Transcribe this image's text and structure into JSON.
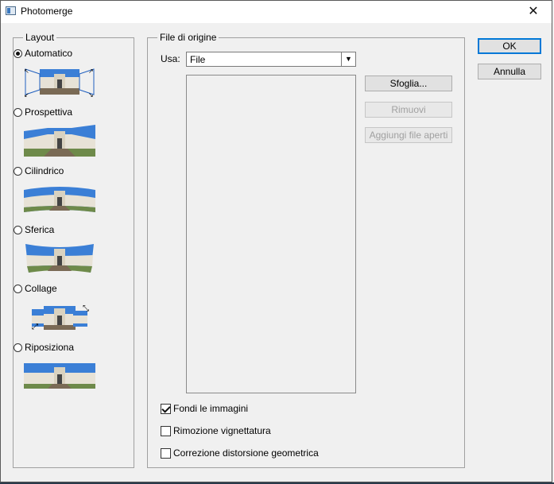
{
  "window": {
    "title": "Photomerge"
  },
  "layout": {
    "legend": "Layout",
    "options": [
      {
        "label": "Automatico",
        "checked": true
      },
      {
        "label": "Prospettiva",
        "checked": false
      },
      {
        "label": "Cilindrico",
        "checked": false
      },
      {
        "label": "Sferica",
        "checked": false
      },
      {
        "label": "Collage",
        "checked": false
      },
      {
        "label": "Riposiziona",
        "checked": false
      }
    ]
  },
  "source": {
    "legend": "File di origine",
    "use_label": "Usa:",
    "use_value": "File",
    "browse_label": "Sfoglia...",
    "remove_label": "Rimuovi",
    "add_open_label": "Aggiungi file aperti"
  },
  "options": {
    "blend_label": "Fondi le immagini",
    "blend_checked": true,
    "vignette_label": "Rimozione vignettatura",
    "vignette_checked": false,
    "distortion_label": "Correzione distorsione geometrica",
    "distortion_checked": false
  },
  "actions": {
    "ok_label": "OK",
    "cancel_label": "Annulla"
  },
  "colors": {
    "sky": "#3b7fd6",
    "building": "#e7e2d6",
    "ground": "#7a6a55",
    "grass": "#6e8a4a",
    "accent": "#0078d7"
  }
}
